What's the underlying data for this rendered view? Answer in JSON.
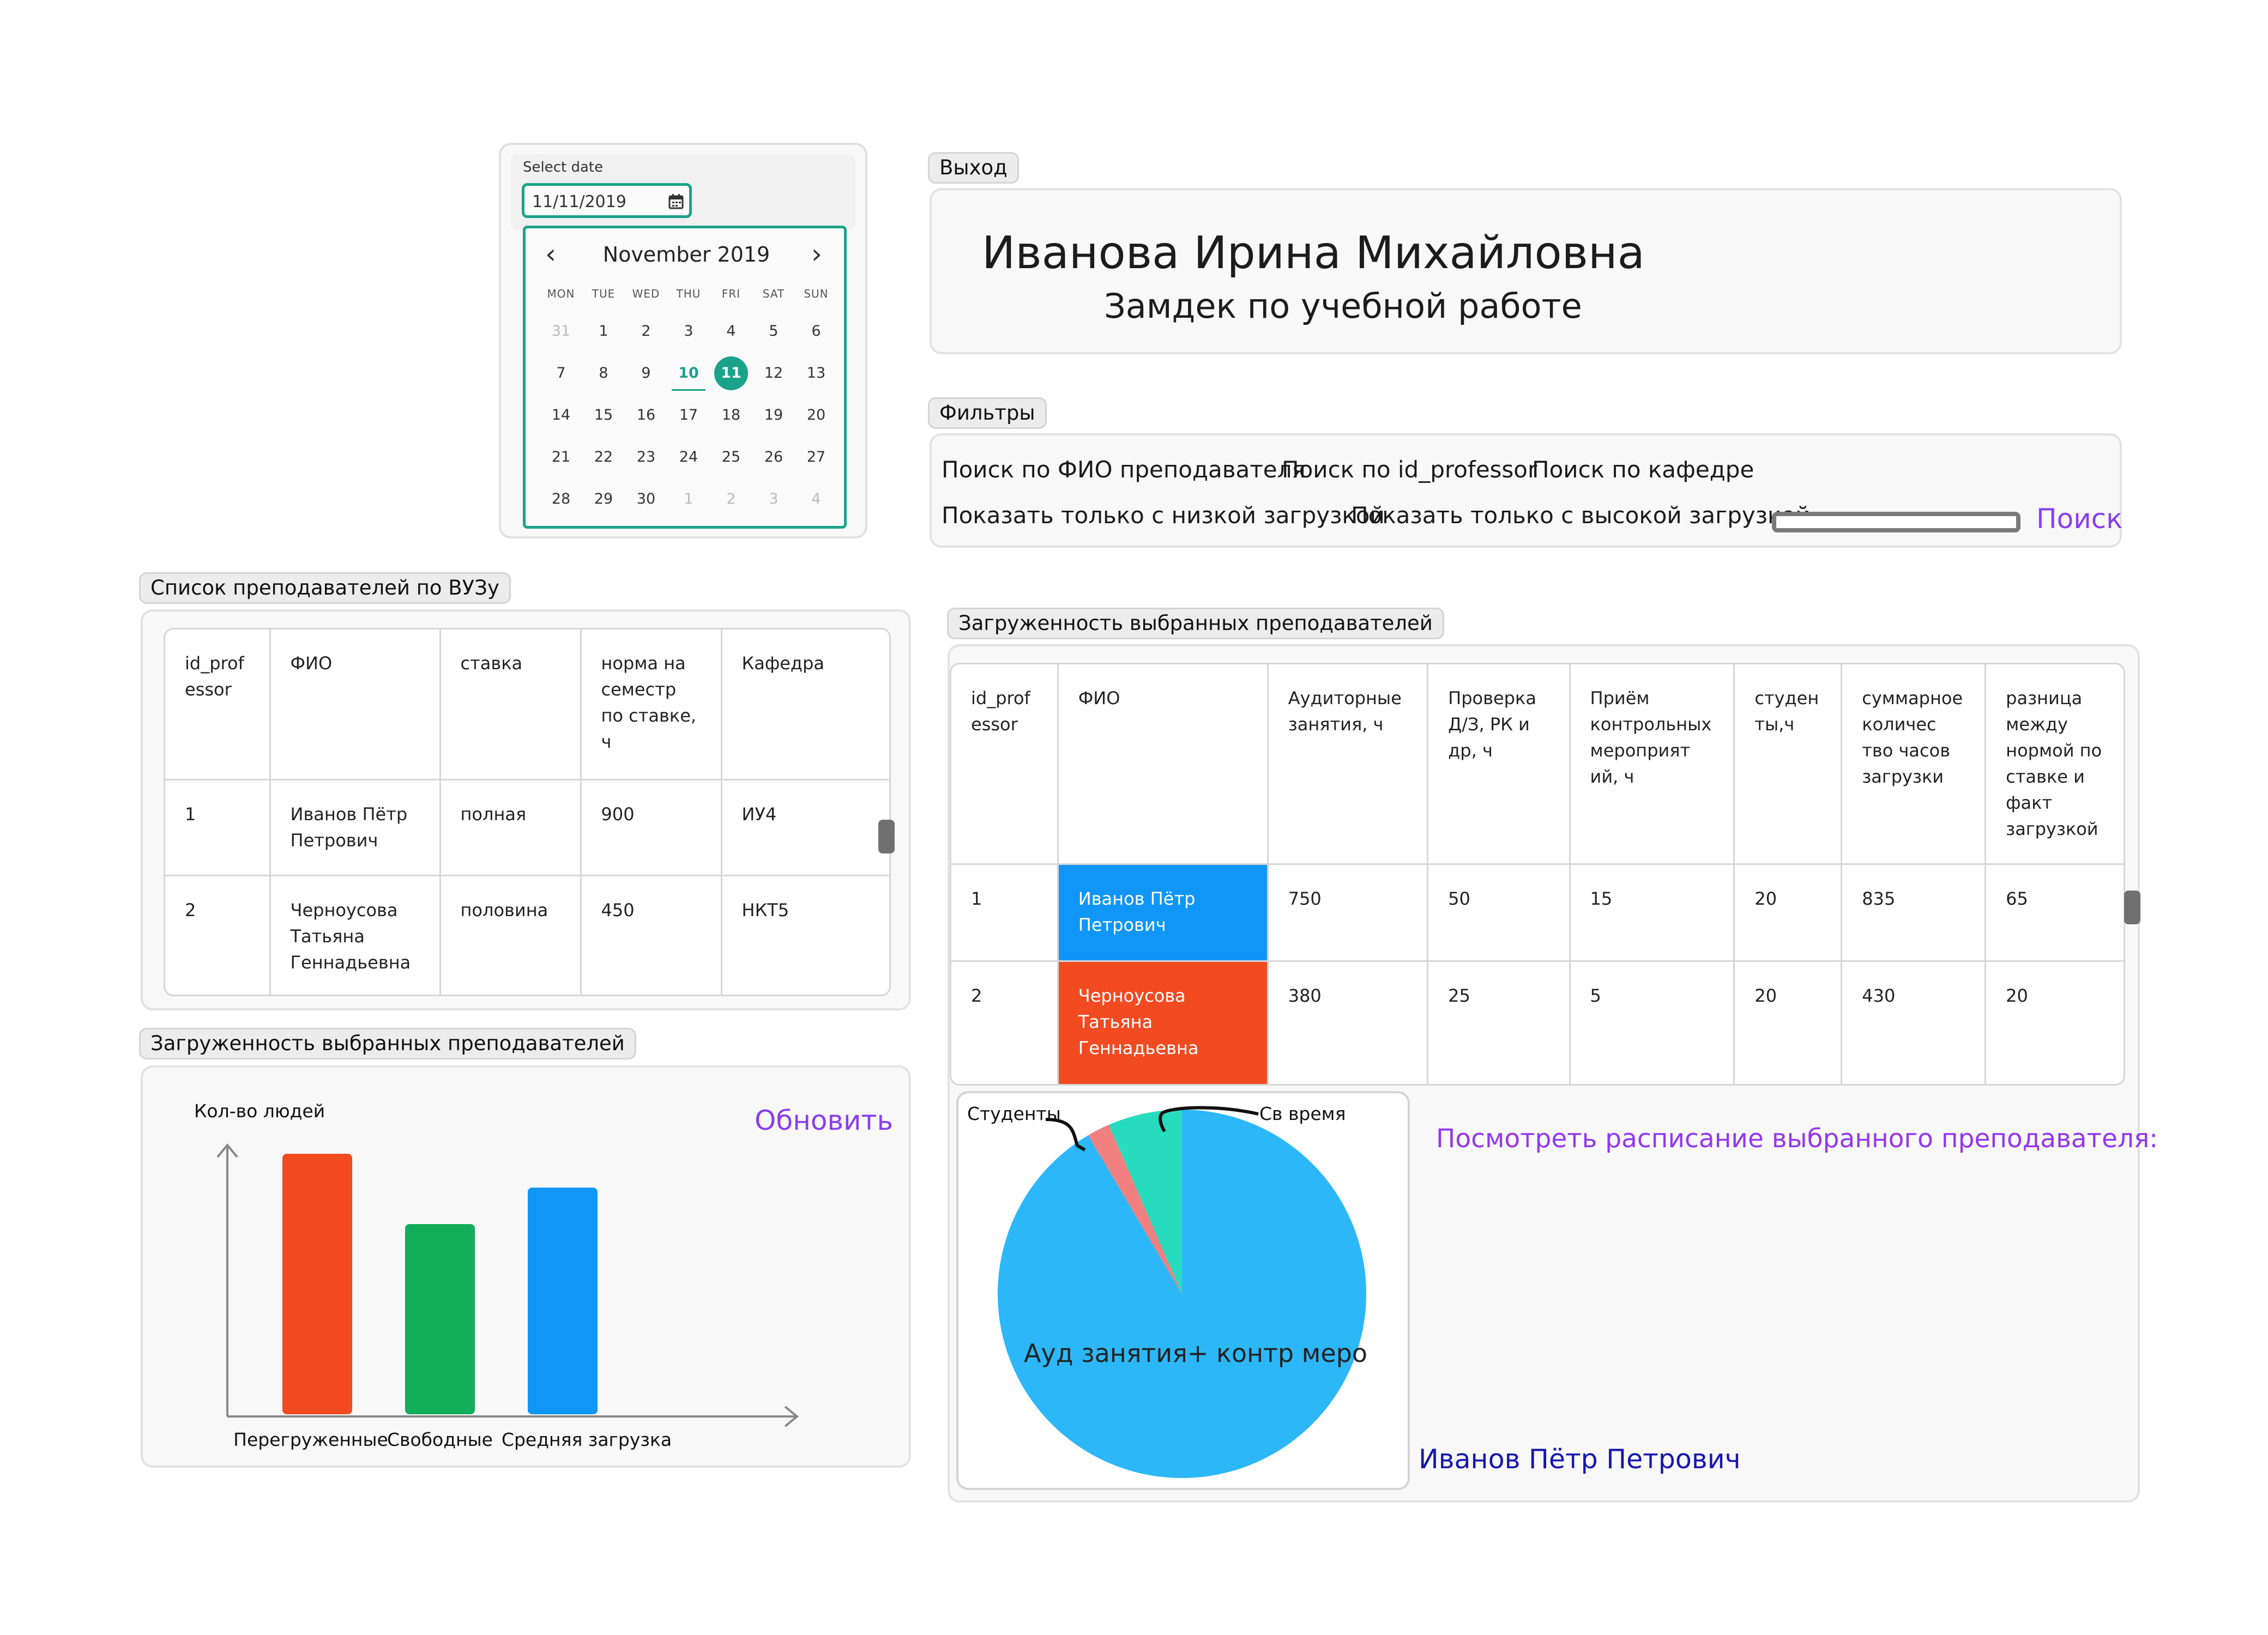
{
  "calendar": {
    "label": "Select date",
    "value": "11/11/2019",
    "month": "November 2019",
    "prev": "‹",
    "next": "›",
    "weekdays": [
      "MON",
      "TUE",
      "WED",
      "THU",
      "FRI",
      "SAT",
      "SUN"
    ],
    "days": [
      "31",
      "1",
      "2",
      "3",
      "4",
      "5",
      "6",
      "7",
      "8",
      "9",
      "10",
      "11",
      "12",
      "13",
      "14",
      "15",
      "16",
      "17",
      "18",
      "19",
      "20",
      "21",
      "22",
      "23",
      "24",
      "25",
      "26",
      "27",
      "28",
      "29",
      "30",
      "1",
      "2",
      "3",
      "4"
    ],
    "today": "10",
    "selected": "11",
    "accent": "#1aa28a"
  },
  "header": {
    "exit_label": "Выход",
    "name": "Иванова Ирина Михайловна",
    "role": "Замдек по учебной работе"
  },
  "filters": {
    "title": "Фильтры",
    "search_fio": "Поиск по ФИО преподавателя",
    "search_id": "Поиск по id_professor",
    "search_dept": "Поиск по кафедре",
    "low_load": "Показать только с низкой загрузкой",
    "high_load": "Показать только с высокой загрузкой",
    "search_button": "Поиск"
  },
  "teachers_list": {
    "title": "Список преподавателей по ВУЗу",
    "columns": [
      "id_prof essor",
      "ФИО",
      "ставка",
      "норма на семестр по ставке, ч",
      "Кафедра"
    ],
    "rows": [
      [
        "1",
        "Иванов Пётр Петрович",
        "полная",
        "900",
        "ИУ4"
      ],
      [
        "2",
        "Черноусова Татьяна Геннадьевна",
        "половина",
        "450",
        "НКТ5"
      ]
    ]
  },
  "load_chart": {
    "title": "Загруженность выбранных преподавателей",
    "refresh_button": "Обновить",
    "chart_data": {
      "type": "bar",
      "ylabel": "Кол-во людей",
      "categories": [
        "Перегруженные",
        "Свободные",
        "Средняя загрузка"
      ],
      "values": [
        1.0,
        0.73,
        0.87
      ],
      "colors": [
        "#f24b22",
        "#12ad5b",
        "#0f96f8"
      ]
    }
  },
  "load_table": {
    "title": "Загруженность выбранных преподавателей",
    "columns": [
      "id_prof essor",
      "ФИО",
      "Аудиторные занятия, ч",
      "Проверка Д/З, РК и др, ч",
      "Приём контрольных мероприят ий, ч",
      "студен ты,ч",
      "суммарное количес тво часов загрузки",
      "разница между нормой по ставке и факт загрузкой"
    ],
    "rows": [
      [
        "1",
        "Иванов Пётр Петрович",
        "750",
        "50",
        "15",
        "20",
        "835",
        "65"
      ],
      [
        "2",
        "Черноусова Татьяна Геннадьевна",
        "380",
        "25",
        "5",
        "20",
        "430",
        "20"
      ]
    ],
    "row_colors": [
      "#0f96f8",
      "#f24b22"
    ]
  },
  "pie_chart": {
    "chart_data": {
      "type": "pie",
      "slices": [
        {
          "label": "Ауд занятия+ контр меро",
          "value": 0.915,
          "color": "#2cb7f8"
        },
        {
          "label": "Студенты",
          "value": 0.02,
          "color": "#f27f7f"
        },
        {
          "label": "Св время",
          "value": 0.065,
          "color": "#27dcbe"
        }
      ]
    }
  },
  "schedule": {
    "link": "Посмотреть расписание выбранного преподавателя:",
    "teacher_name": "Иванов Пётр Петрович"
  }
}
